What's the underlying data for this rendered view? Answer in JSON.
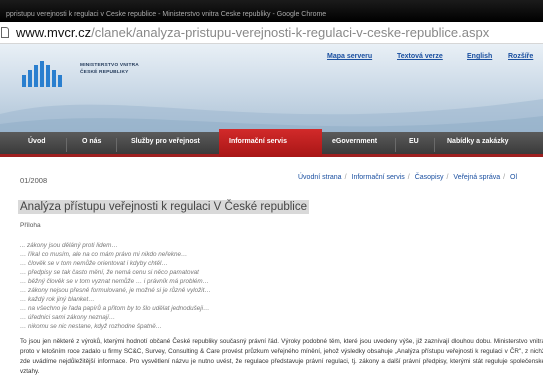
{
  "window": {
    "title": "ppristupu verejnosti k regulaci v Ceske republice - Ministerstvo vnitra Ceske republiky - Google Chrome"
  },
  "address_bar": {
    "host": "www.mvcr.cz",
    "path": "/clanek/analyza-pristupu-verejnosti-k-regulaci-v-ceske-republice.aspx"
  },
  "logo": {
    "line1": "MINISTERSTVO VNITRA",
    "line2": "ČESKÉ REPUBLIKY"
  },
  "top_links": [
    "Mapa serveru",
    "Textová verze",
    "English",
    "Rozšíře"
  ],
  "nav": {
    "items": [
      "Úvod",
      "O nás",
      "Služby pro veřejnost",
      "Informační servis",
      "eGovernment",
      "EU",
      "Nabídky a zakázky"
    ],
    "active_index": 3
  },
  "article": {
    "issue": "01/2008",
    "breadcrumb": [
      "Úvodní strana",
      "Informační servis",
      "Časopisy",
      "Veřejná správa",
      "Ol"
    ],
    "title": "Analýza přístupu veřejnosti k regulaci V České republice",
    "attachment_label": "Příloha",
    "quotes": [
      "... zákony jsou děláný proti lidem…",
      "… říkal co musím, ale na co mám právo mi nikdo neřekne…",
      "… člověk se v tom nemůže orientovat i kdyby chtěl…",
      "… předpisy se tak často mění, že nemá cenu si něco pamatovat",
      "… běžný člověk se v tom vyznat nemůže … i právník má problém…",
      "… zákony nejsou přesně formulované, je možné si je různě vyložit…",
      "… každý rok jiný blanket…",
      "… na všechno je řada papírů a přitom by to šlo udělat jednodušeji…",
      "… úřednici sami zákony neznají…",
      "… nikomu se nic nestane, když rozhodne špatně…"
    ],
    "paragraph": "To jsou jen některé z výroků, kterými hodnotí občané České republiky současný právní řád. Výroky podobné těm, které jsou uvedeny výše, již zaznívají dlouhou dobu. Ministerstvo vnitra proto v letošním roce zadalo u firmy SC&C, Survey, Consulting & Care provést průzkum veřejného mínění, jehož výsledky obsahuje „Analýza přístupu veřejnosti k regulaci v ČR\", z nichž zde uvádíme nejdůležitější informace. Pro vysvětlení názvu je nutno uvést, že regulace představuje právní regulaci, tj. zákony a další právní předpisy, kterými stát reguluje společenské vztahy."
  },
  "colors": {
    "nav_bg": "#454545",
    "nav_active": "#c21f1f",
    "link": "#1a4fa0",
    "logo_blue": "#2a7fcf"
  }
}
